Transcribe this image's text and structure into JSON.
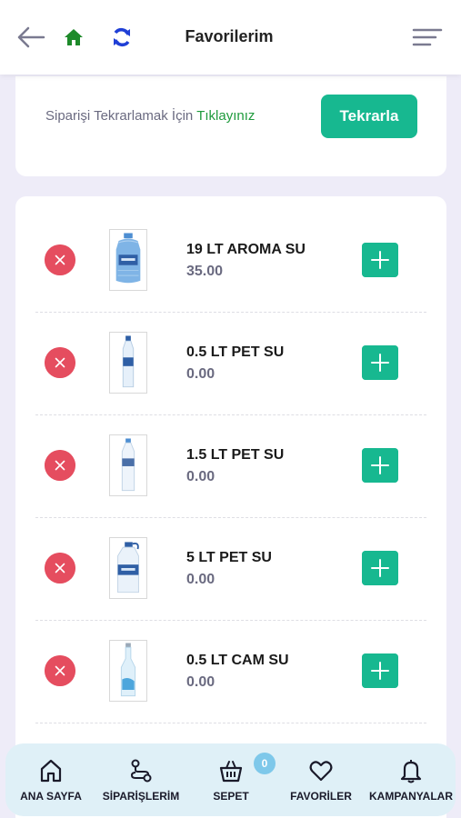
{
  "header": {
    "title": "Favorilerim",
    "icons": {
      "back": "arrow-left-icon",
      "home": "home-icon",
      "refresh": "refresh-icon",
      "menu": "menu-icon"
    },
    "colors": {
      "home": "#1e8a2a",
      "refresh": "#1f3fd6"
    }
  },
  "repeat_order": {
    "text": "Siparişi Tekrarlamak İçin",
    "link_text": "Tıklayınız",
    "button_label": "Tekrarla"
  },
  "favorites": [
    {
      "name": "19 LT AROMA SU",
      "price": "35.00",
      "image": "water-jug-19lt"
    },
    {
      "name": "0.5 LT PET SU",
      "price": "0.00",
      "image": "pet-bottle-small"
    },
    {
      "name": "1.5 LT PET SU",
      "price": "0.00",
      "image": "pet-bottle-medium"
    },
    {
      "name": "5 LT PET SU",
      "price": "0.00",
      "image": "pet-bottle-large"
    },
    {
      "name": "0.5 LT CAM SU",
      "price": "0.00",
      "image": "glass-bottle"
    }
  ],
  "bottom_nav": {
    "items": [
      {
        "label": "ANA SAYFA",
        "icon": "home-icon"
      },
      {
        "label": "SİPARİŞLERİM",
        "icon": "route-icon"
      },
      {
        "label": "SEPET",
        "icon": "basket-icon"
      },
      {
        "label": "FAVORİLER",
        "icon": "heart-icon"
      },
      {
        "label": "KAMPANYALAR",
        "icon": "bell-icon"
      }
    ],
    "cart_count": "0"
  },
  "colors": {
    "accent": "#17b890",
    "remove": "#e54d5f",
    "link": "#1e9a3c",
    "background": "#eeecf8",
    "nav_background": "#dff0f7"
  }
}
